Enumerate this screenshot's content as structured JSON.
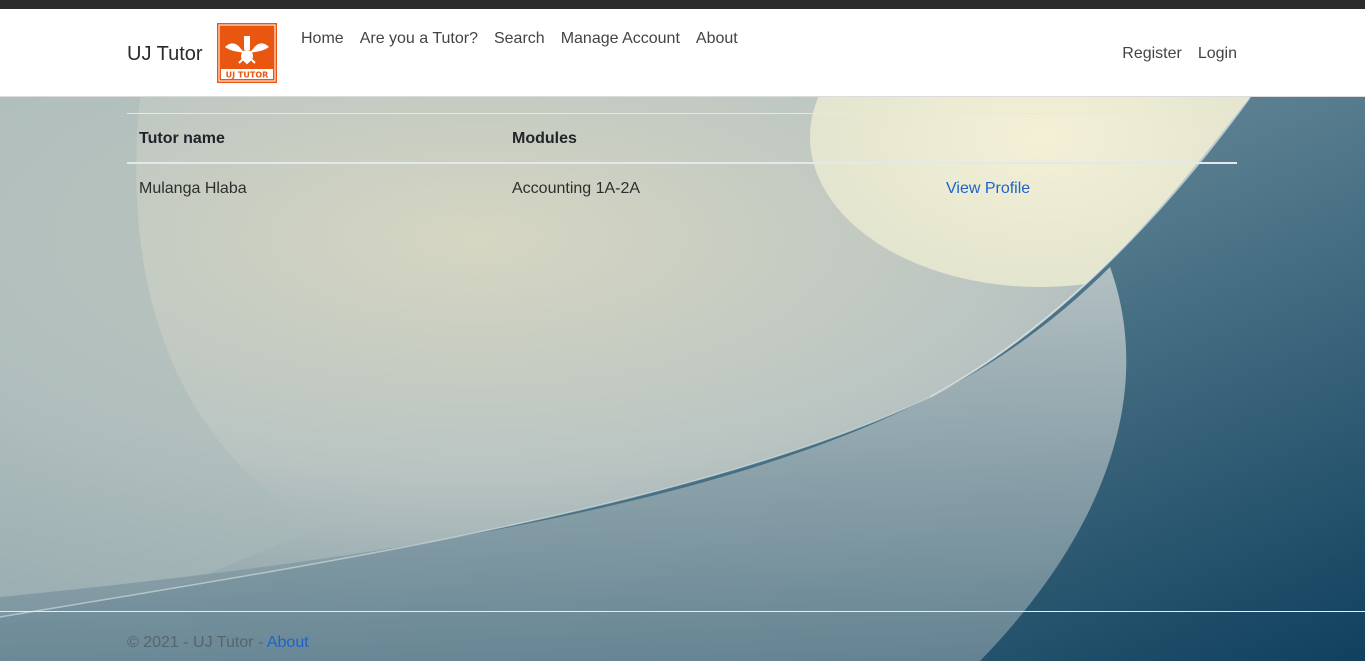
{
  "brand": {
    "name": "UJ Tutor",
    "logo_text": "UJ TUTOR"
  },
  "nav": {
    "links": [
      "Home",
      "Are you a Tutor?",
      "Search",
      "Manage Account",
      "About"
    ],
    "right": [
      "Register",
      "Login"
    ]
  },
  "table": {
    "headers": [
      "Tutor name",
      "Modules",
      ""
    ],
    "rows": [
      {
        "name": "Mulanga Hlaba",
        "modules": "Accounting 1A-2A",
        "action": "View Profile"
      }
    ]
  },
  "footer": {
    "text": "© 2021 - UJ Tutor - ",
    "link": "About"
  },
  "colors": {
    "logo_bg": "#e8560f",
    "link": "#1c64c8",
    "nav_bg": "#ffffff"
  }
}
